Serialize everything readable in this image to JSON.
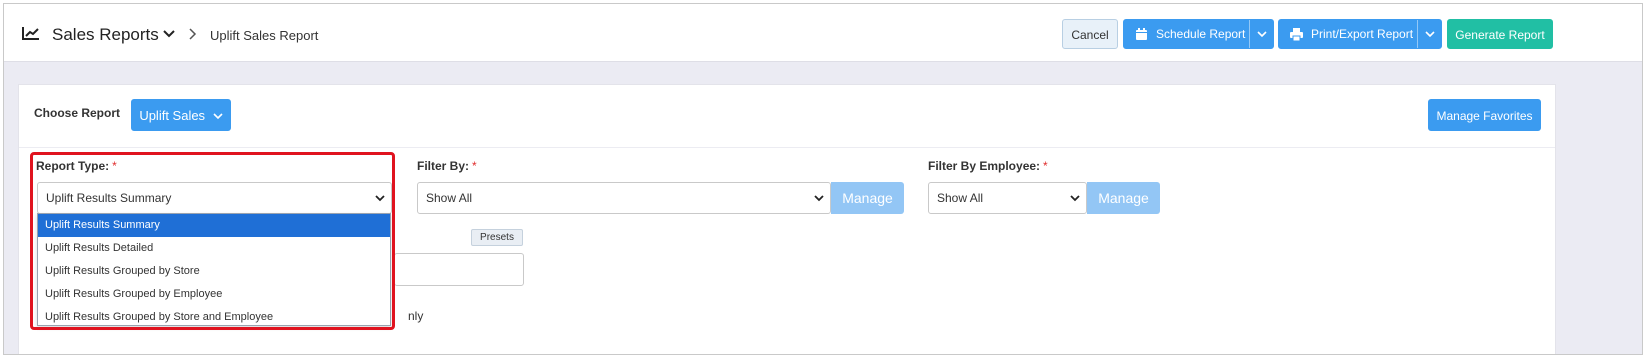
{
  "header": {
    "app_title": "Sales Reports",
    "breadcrumb": "Uplift Sales Report",
    "icons": {
      "app": "chart-line-icon",
      "title_dropdown": "chevron-down-icon",
      "separator": "chevron-right-icon"
    }
  },
  "toolbar": {
    "cancel_label": "Cancel",
    "schedule_label": "Schedule Report",
    "print_label": "Print/Export Report",
    "generate_label": "Generate Report",
    "icons": {
      "schedule": "calendar-icon",
      "print": "printer-icon",
      "split_caret": "chevron-down-icon"
    }
  },
  "choose_report": {
    "label": "Choose Report",
    "selected": "Uplift Sales",
    "manage_favorites_label": "Manage Favorites"
  },
  "filters": {
    "required_mark": "*",
    "report_type": {
      "label": "Report Type:",
      "value": "Uplift Results Summary",
      "options": [
        "Uplift Results Summary",
        "Uplift Results Detailed",
        "Uplift Results Grouped by Store",
        "Uplift Results Grouped by Employee",
        "Uplift Results Grouped by Store and Employee"
      ],
      "selected_index": 0
    },
    "filter_by": {
      "label": "Filter By:",
      "value": "Show All",
      "manage_label": "Manage"
    },
    "filter_by_employee": {
      "label": "Filter By Employee:",
      "value": "Show All",
      "manage_label": "Manage"
    },
    "presets_label": "Presets",
    "partial_text": "nly"
  },
  "colors": {
    "primary": "#3b9bf0",
    "generate": "#21bfa4",
    "manage_disabled": "#93c6f5",
    "highlight": "#e0131f",
    "dropdown_selected": "#1f6fd6"
  }
}
